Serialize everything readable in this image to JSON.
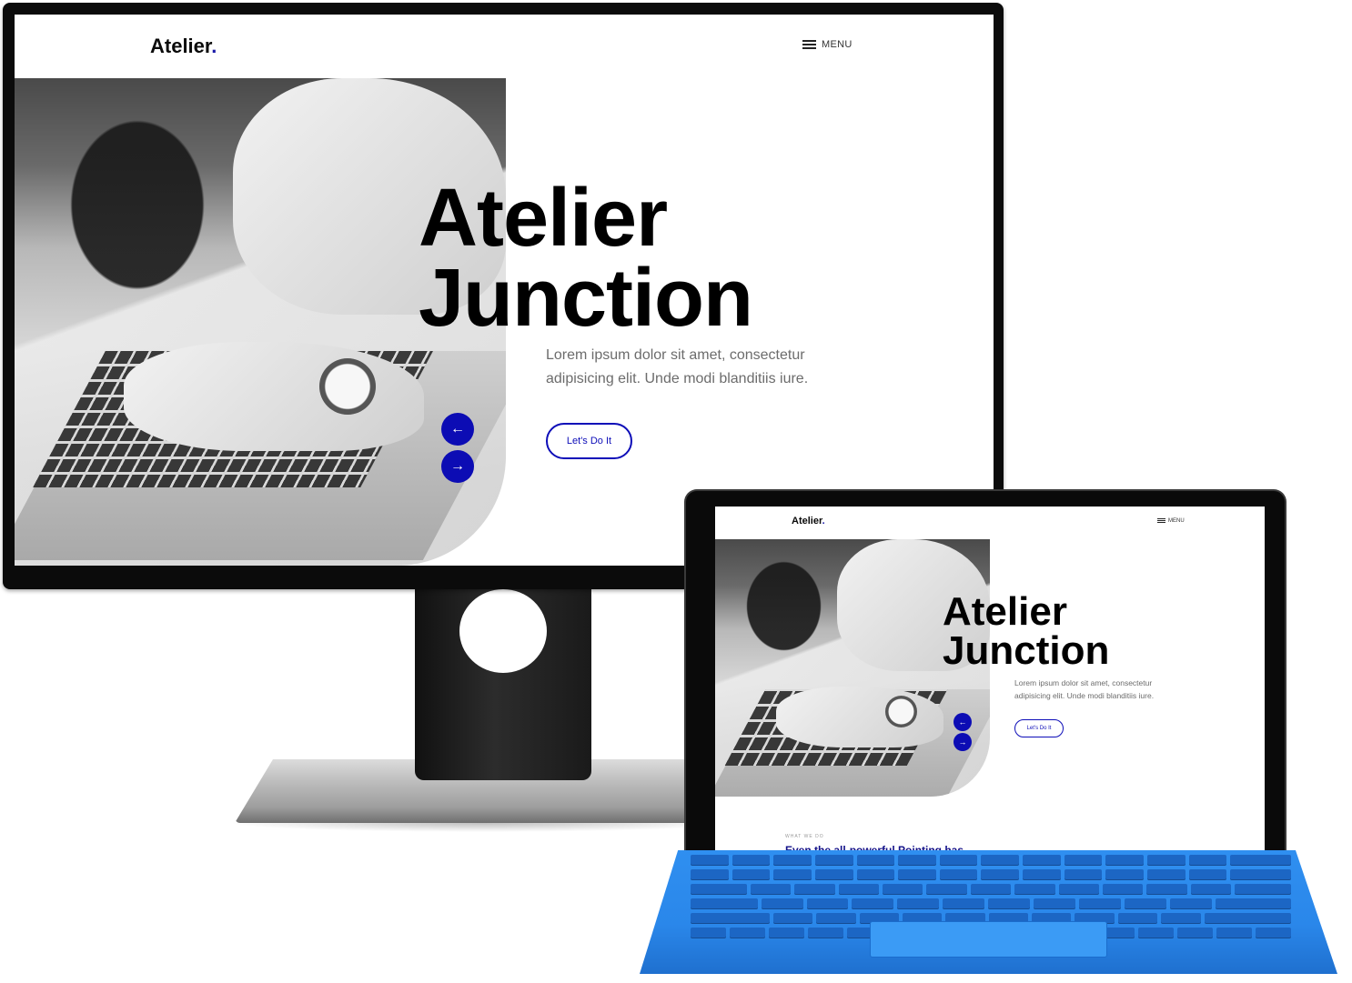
{
  "site": {
    "logo_text": "Atelier",
    "logo_dot": ".",
    "menu_label": "MENU",
    "hero_title_line1": "Atelier",
    "hero_title_line2": "Junction",
    "hero_text": "Lorem ipsum dolor sit amet, consectetur adipisicing elit. Unde modi blanditiis iure.",
    "cta_label": "Let's Do It",
    "prev_arrow": "←",
    "next_arrow": "→",
    "section_overline": "WHAT WE DO",
    "section_title": "Even the all-powerful Pointing has"
  },
  "colors": {
    "accent": "#0c0cb4",
    "keyboard": "#2a87ea"
  },
  "icons": {
    "menu": "hamburger-icon",
    "prev": "arrow-left-icon",
    "next": "arrow-right-icon"
  }
}
